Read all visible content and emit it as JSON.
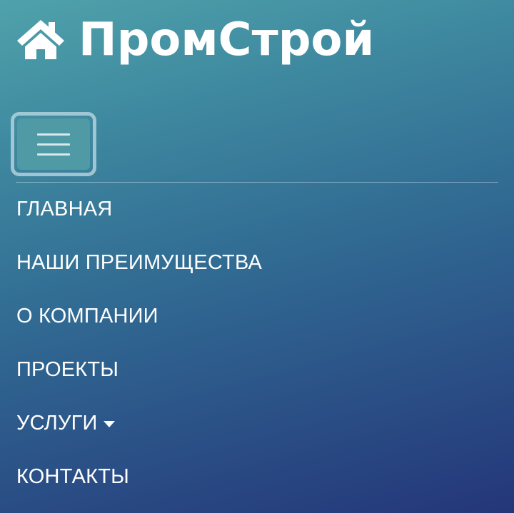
{
  "brand": {
    "name": "ПромСтрой",
    "icon": "home-icon"
  },
  "navbar": {
    "toggler_icon": "hamburger-icon"
  },
  "nav": {
    "items": [
      {
        "label": "ГЛАВНАЯ"
      },
      {
        "label": "НАШИ ПРЕИМУЩЕСТВА"
      },
      {
        "label": "О КОМПАНИИ"
      },
      {
        "label": "ПРОЕКТЫ"
      },
      {
        "label": "УСЛУГИ",
        "dropdown_icon": "caret-down-icon"
      },
      {
        "label": "КОНТАКТЫ"
      }
    ]
  },
  "colors": {
    "gradient_top": "#4fa2ab",
    "gradient_bottom": "#243679",
    "text": "#ffffff",
    "toggler_fill": "#4f9aa5"
  }
}
